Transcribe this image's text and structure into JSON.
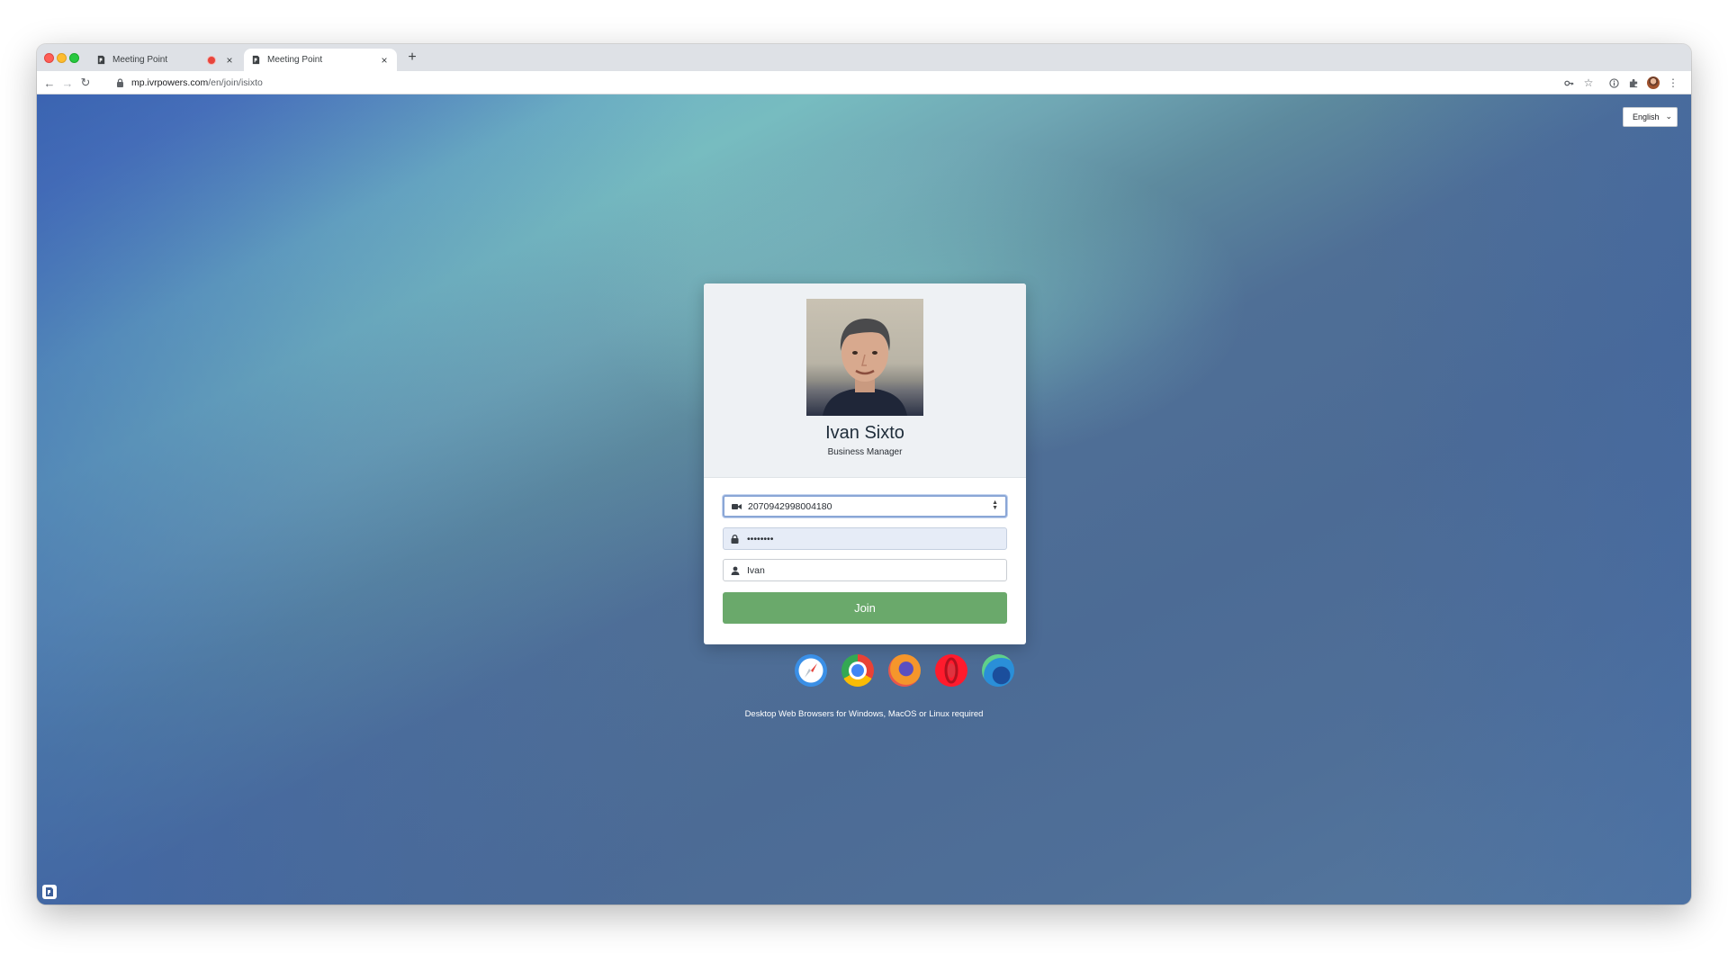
{
  "browser": {
    "tabs": [
      {
        "title": "Meeting Point",
        "active": false,
        "recording": true
      },
      {
        "title": "Meeting Point",
        "active": true,
        "recording": false
      }
    ],
    "new_tab_label": "+",
    "url_host": "mp.ivrpowers.com",
    "url_path": "/en/join/isixto"
  },
  "language_select": {
    "value": "English"
  },
  "profile": {
    "name": "Ivan Sixto",
    "title": "Business Manager"
  },
  "form": {
    "meeting_id": "2070942998004180",
    "password_masked": "••••••••",
    "display_name": "Ivan",
    "join_label": "Join"
  },
  "browsers": {
    "icons": [
      "safari-icon",
      "chrome-icon",
      "firefox-icon",
      "opera-icon",
      "edge-icon"
    ],
    "note": "Desktop Web Browsers for Windows, MacOS or Linux required"
  },
  "colors": {
    "join_button": "#6aa96b",
    "background_blue": "#4f6f96",
    "background_teal": "#77bcc0"
  }
}
